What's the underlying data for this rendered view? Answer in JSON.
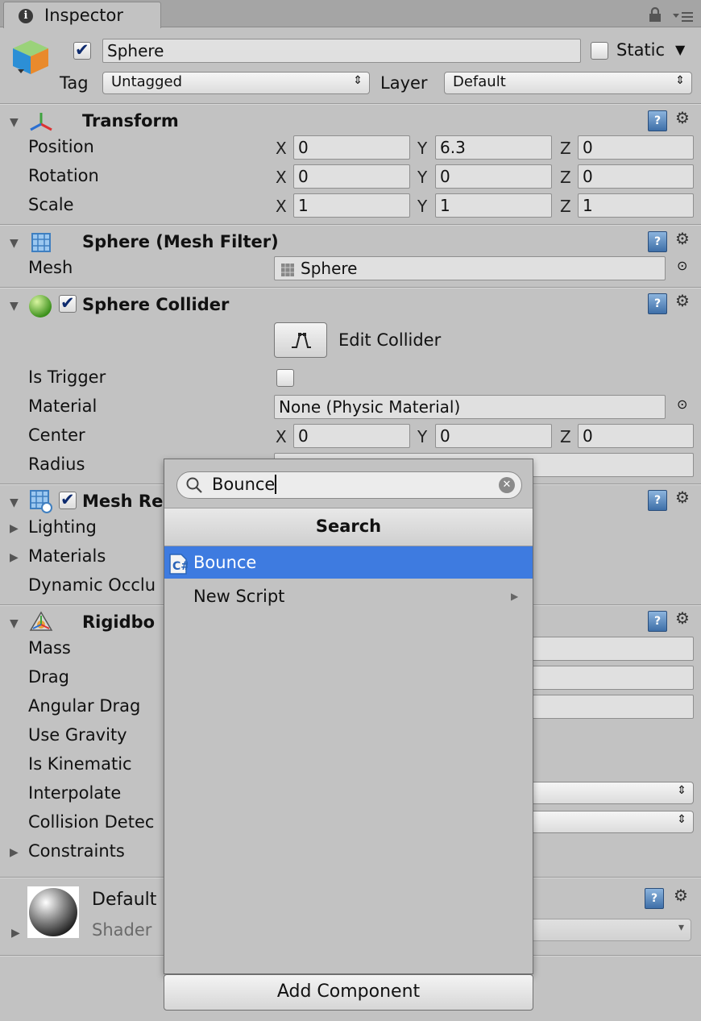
{
  "tab": {
    "label": "Inspector"
  },
  "gameobject": {
    "active": true,
    "name": "Sphere",
    "static_label": "Static",
    "tag_label": "Tag",
    "tag_value": "Untagged",
    "layer_label": "Layer",
    "layer_value": "Default"
  },
  "transform": {
    "title": "Transform",
    "rows": [
      {
        "label": "Position",
        "x": "0",
        "y": "6.3",
        "z": "0"
      },
      {
        "label": "Rotation",
        "x": "0",
        "y": "0",
        "z": "0"
      },
      {
        "label": "Scale",
        "x": "1",
        "y": "1",
        "z": "1"
      }
    ]
  },
  "axes": {
    "x": "X",
    "y": "Y",
    "z": "Z"
  },
  "mesh_filter": {
    "title": "Sphere (Mesh Filter)",
    "mesh_label": "Mesh",
    "mesh_value": "Sphere"
  },
  "sphere_collider": {
    "title": "Sphere Collider",
    "enabled": true,
    "edit_label": "Edit Collider",
    "is_trigger_label": "Is Trigger",
    "material_label": "Material",
    "material_value": "None (Physic Material)",
    "center_label": "Center",
    "center": {
      "x": "0",
      "y": "0",
      "z": "0"
    },
    "radius_label": "Radius"
  },
  "mesh_renderer": {
    "title": "Mesh Re",
    "lighting_label": "Lighting",
    "materials_label": "Materials",
    "dynamic_occlusion_label": "Dynamic Occlu"
  },
  "rigidbody": {
    "title": "Rigidbo",
    "mass_label": "Mass",
    "drag_label": "Drag",
    "angular_drag_label": "Angular Drag",
    "use_gravity_label": "Use Gravity",
    "is_kinematic_label": "Is Kinematic",
    "interpolate_label": "Interpolate",
    "collision_label": "Collision Detec",
    "constraints_label": "Constraints"
  },
  "material": {
    "title": "Default",
    "shader_label": "Shader"
  },
  "add_component": {
    "search_value": "Bounce",
    "header": "Search",
    "items": [
      {
        "label": "Bounce",
        "selected": true
      },
      {
        "label": "New Script",
        "submenu": true
      }
    ],
    "button_label": "Add Component"
  },
  "colors": {
    "selection": "#3e7be0",
    "panel": "#c2c2c2",
    "field": "#e0e0e0"
  }
}
